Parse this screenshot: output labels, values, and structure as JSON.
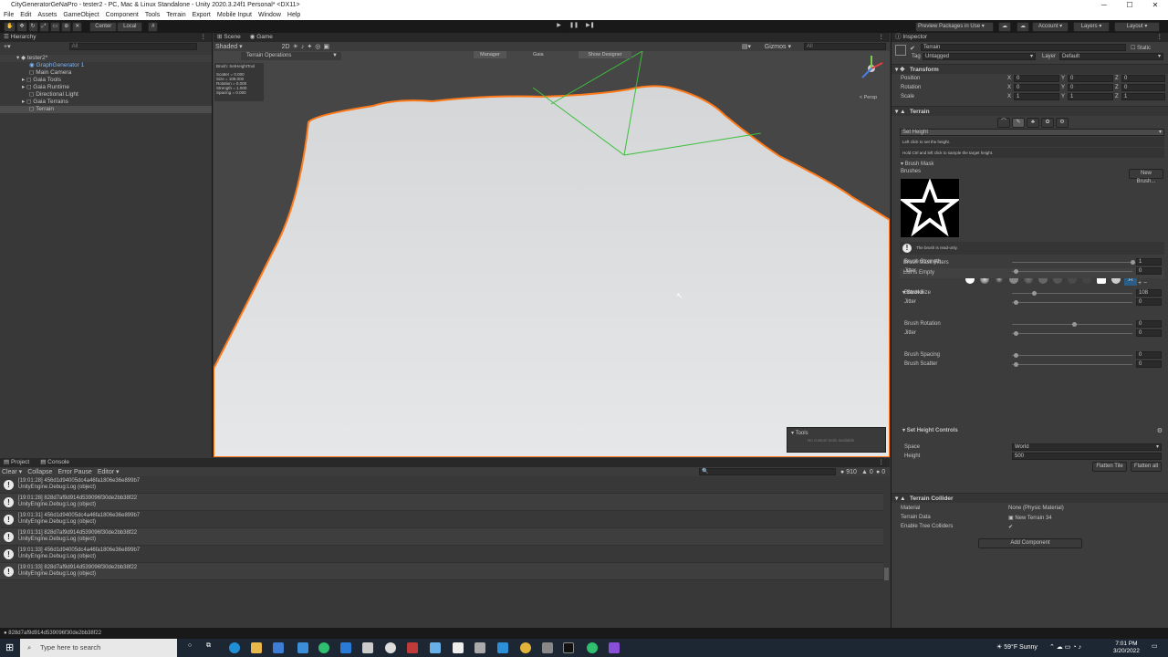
{
  "window": {
    "title": "CityGeneratorGeNaPro - tester2 - PC, Mac & Linux Standalone - Unity 2020.3.24f1 Personal* <DX11>",
    "min": "─",
    "max": "☐",
    "close": "✕"
  },
  "menu": [
    "File",
    "Edit",
    "Assets",
    "GameObject",
    "Component",
    "Tools",
    "Terrain",
    "Export",
    "Mobile Input",
    "Window",
    "Help"
  ],
  "toolbar": {
    "pivot": "Center",
    "space": "Local",
    "preview": "Preview Packages in Use",
    "account": "Account",
    "layers": "Layers",
    "layout": "Layout",
    "play": "▶",
    "pause": "❚❚",
    "step": "▶❚"
  },
  "hierarchy": {
    "tab": "Hierarchy",
    "search": "All",
    "scene": "tester2*",
    "items": [
      "GraphGenerator 1",
      "Main Camera",
      "Gaia Tools",
      "Gaia Runtime",
      "Directional Light",
      "Gaia Terrains",
      "Terrain"
    ]
  },
  "scene": {
    "tab_scene": "Scene",
    "tab_game": "Game",
    "shading": "Shaded",
    "mode2d": "2D",
    "overlay_title": "Terrain Operations",
    "overlay_lines": [
      "Brush: SetHeightTool",
      "Scatter = 0.000",
      "Size = 108.000",
      "Rotation = 0.000",
      "Strength = 1.000",
      "Spacing = 0.000"
    ],
    "btn_manager": "Manager",
    "btn_gaia": "Gaia",
    "btn_show_designer": "Show Designer",
    "gizmos": "Gizmos",
    "search": "All",
    "persp": "< Persp",
    "tools_title": "Tools",
    "tools_empty": "No custom tools available"
  },
  "console": {
    "tab_project": "Project",
    "tab_console": "Console",
    "clear": "Clear",
    "collapse": "Collapse",
    "error_pause": "Error Pause",
    "editor": "Editor",
    "counts": [
      "910",
      "0",
      "0"
    ],
    "entries": [
      {
        "line1": "[19:01:28] 456d1d94005dc4a46fa1806e36e899b7",
        "line2": "UnityEngine.Debug:Log (object)"
      },
      {
        "line1": "[19:01:28] 828d7af9d914d539096f30de2bb38f22",
        "line2": "UnityEngine.Debug:Log (object)"
      },
      {
        "line1": "[19:01:31] 456d1d94005dc4a46fa1806e36e899b7",
        "line2": "UnityEngine.Debug:Log (object)"
      },
      {
        "line1": "[19:01:31] 828d7af9d914d539096f30de2bb38f22",
        "line2": "UnityEngine.Debug:Log (object)"
      },
      {
        "line1": "[19:01:33] 456d1d94005dc4a46fa1806e36e899b7",
        "line2": "UnityEngine.Debug:Log (object)"
      },
      {
        "line1": "[19:01:33] 828d7af9d914d539096f30de2bb38f22",
        "line2": "UnityEngine.Debug:Log (object)"
      }
    ]
  },
  "inspector": {
    "tab": "Inspector",
    "object_name": "Terrain",
    "static": "Static",
    "tag_label": "Tag",
    "tag": "Untagged",
    "layer_label": "Layer",
    "layer": "Default",
    "transform": {
      "title": "Transform",
      "rows": [
        {
          "label": "Position",
          "x": "0",
          "y": "0",
          "z": "0"
        },
        {
          "label": "Rotation",
          "x": "0",
          "y": "0",
          "z": "0"
        },
        {
          "label": "Scale",
          "x": "1",
          "y": "1",
          "z": "1"
        }
      ],
      "ax": "X",
      "ay": "Y",
      "az": "Z"
    },
    "terrain": {
      "title": "Terrain",
      "tool": "Set Height",
      "help1": "Left click to set the height.",
      "help2": "Hold Ctrl and left click to sample the target height.",
      "brush_mask": "Brush Mask",
      "brushes": "Brushes",
      "new_brush": "New Brush...",
      "readonly": "The brush is read-only.",
      "mask_filters": "Brush Mask Filters",
      "list_empty": "List is Empty",
      "stroke": "Stroke",
      "params": [
        {
          "label": "Brush Strength",
          "value": "1"
        },
        {
          "label": "Jitter",
          "value": "0"
        },
        {
          "label": "Brush Size",
          "value": "108"
        },
        {
          "label": "Jitter",
          "value": "0"
        },
        {
          "label": "Brush Rotation",
          "value": "0"
        },
        {
          "label": "Jitter",
          "value": "0"
        },
        {
          "label": "Brush Spacing",
          "value": "0"
        },
        {
          "label": "Brush Scatter",
          "value": "0"
        }
      ],
      "set_height_controls": "Set Height Controls",
      "space_label": "Space",
      "space": "World",
      "height_label": "Height",
      "height": "500",
      "flatten_tile": "Flatten Tile",
      "flatten_all": "Flatten all"
    },
    "collider": {
      "title": "Terrain Collider",
      "material_label": "Material",
      "material": "None (Physic Material)",
      "data_label": "Terrain Data",
      "data": "New Terrain 34",
      "trees_label": "Enable Tree Colliders"
    },
    "add_component": "Add Component"
  },
  "status": "828d7af9d914d539096f30de2bb38f22",
  "taskbar": {
    "search": "Type here to search",
    "weather": "59°F Sunny",
    "time": "7:01 PM",
    "date": "3/20/2022"
  }
}
